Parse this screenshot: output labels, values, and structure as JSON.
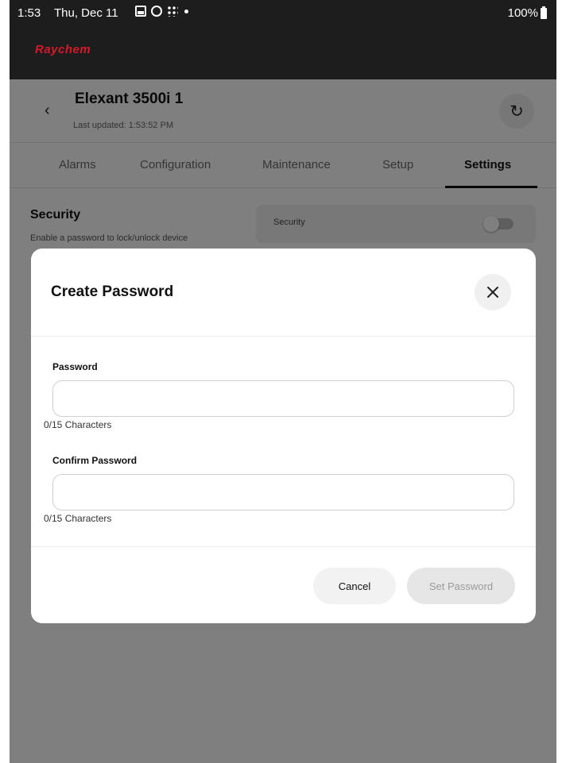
{
  "status_bar": {
    "time": "1:53",
    "date": "Thu, Dec 11",
    "icons": [
      "photo-icon",
      "sync-icon",
      "apps-grid-icon",
      "notification-dot-icon"
    ],
    "battery": "100%"
  },
  "brand": {
    "name": "Raychem",
    "color": "#d6182a"
  },
  "header": {
    "back_icon": "chevron-left-icon",
    "title": "Elexant 3500i 1",
    "last_updated": "Last updated: 1:53:52 PM",
    "refresh_icon": "refresh-icon"
  },
  "tabs": [
    {
      "label": "Alarms",
      "active": false
    },
    {
      "label": "Configuration",
      "active": false
    },
    {
      "label": "Maintenance",
      "active": false
    },
    {
      "label": "Setup",
      "active": false
    },
    {
      "label": "Settings",
      "active": true
    }
  ],
  "security": {
    "title": "Security",
    "description": "Enable a password to lock/unlock device",
    "card_label": "Security",
    "enabled": false
  },
  "modal": {
    "title": "Create Password",
    "close_icon": "close-icon",
    "password": {
      "label": "Password",
      "value": "",
      "placeholder": "",
      "counter": "0/15 Characters"
    },
    "confirm_password": {
      "label": "Confirm Password",
      "value": "",
      "placeholder": "",
      "counter": "0/15 Characters"
    },
    "cancel_label": "Cancel",
    "set_label": "Set Password"
  },
  "colors": {
    "brand_red": "#d6182a",
    "topbar": "#1d1d1d",
    "overlay": "rgba(0,0,0,0.5)",
    "disabled_button": "#e6e6e6"
  }
}
